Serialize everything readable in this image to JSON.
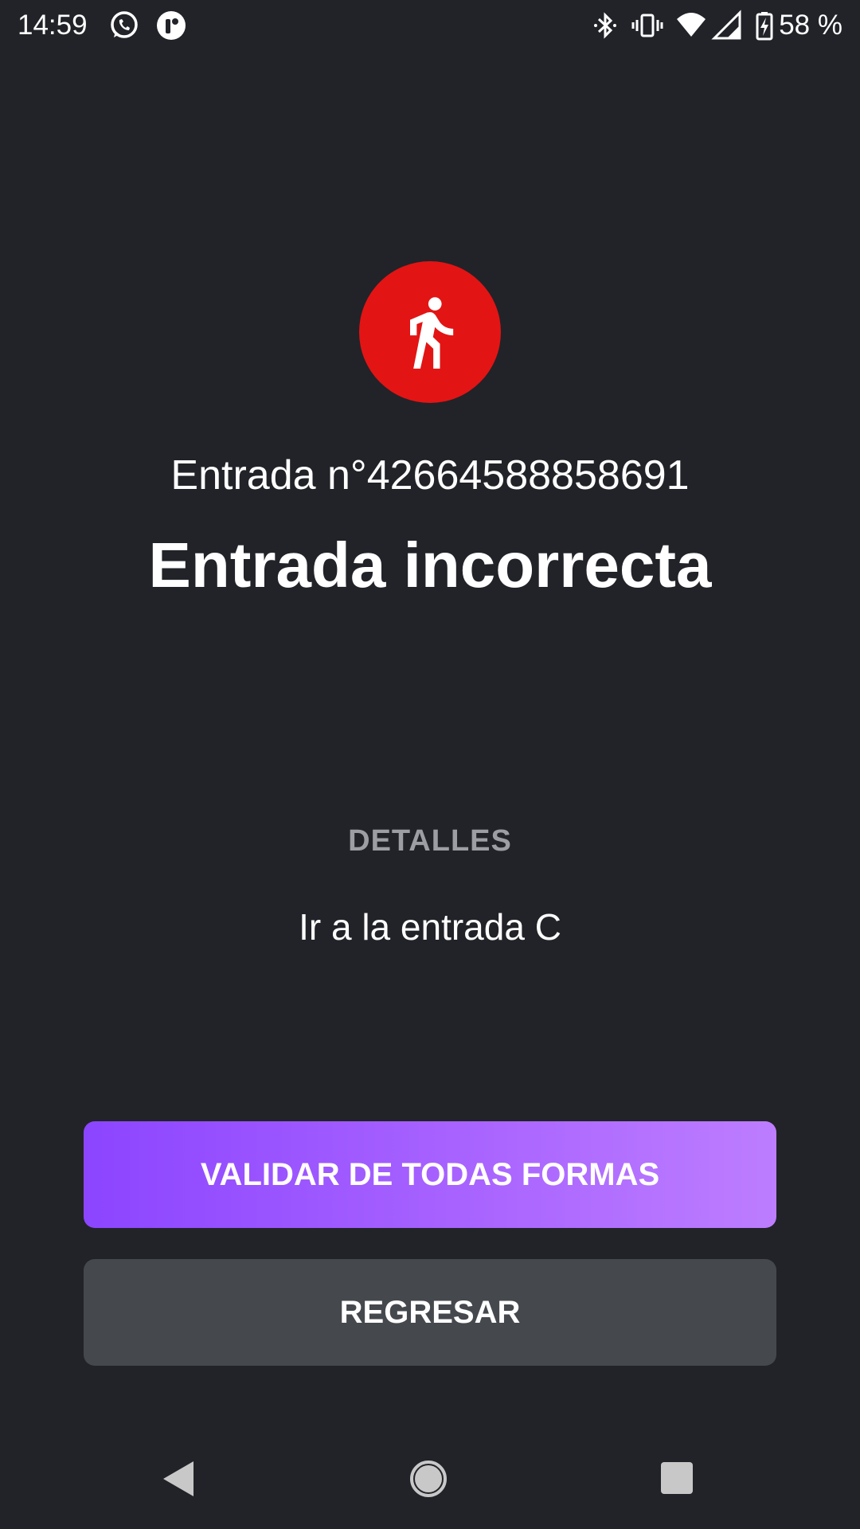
{
  "status_bar": {
    "time": "14:59",
    "battery_percent": "58 %",
    "icons": [
      "whatsapp-icon",
      "app-notification-icon",
      "bluetooth-icon",
      "vibrate-icon",
      "wifi-icon",
      "cell-signal-icon",
      "battery-charging-icon"
    ]
  },
  "result": {
    "status_icon": "walking-person-icon",
    "status_color": "#e31414",
    "ticket_number": "Entrada n°426645888586​91",
    "title": "Entrada incorrecta"
  },
  "details": {
    "label": "DETALLES",
    "text": "Ir a la entrada C"
  },
  "actions": {
    "validate_label": "VALIDAR DE TODAS FORMAS",
    "back_label": "REGRESAR"
  },
  "colors": {
    "background": "#212328",
    "primary_gradient_start": "#8c45ff",
    "primary_gradient_end": "#bd7dff",
    "secondary_button": "#45484c"
  },
  "nav_bar": {
    "icons": [
      "back-icon",
      "home-icon",
      "recent-apps-icon"
    ]
  }
}
